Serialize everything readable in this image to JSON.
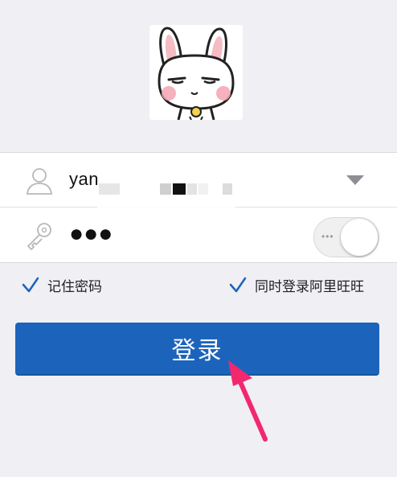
{
  "avatar": {
    "icon": "bunny-avatar-icon"
  },
  "username": {
    "value": "yan",
    "icon": "user-icon",
    "dropdown_icon": "triangle-down-icon"
  },
  "password": {
    "value": "●●●",
    "icon": "key-icon",
    "toggle_on": false
  },
  "options": {
    "remember_password": {
      "label": "记住密码",
      "checked": true
    },
    "login_wangwang": {
      "label": "同时登录阿里旺旺",
      "checked": true
    }
  },
  "login_button": {
    "label": "登录",
    "color": "#1c64bb"
  },
  "colors": {
    "background": "#efeff4",
    "check": "#1c64bb",
    "pointer": "#f2286e"
  }
}
